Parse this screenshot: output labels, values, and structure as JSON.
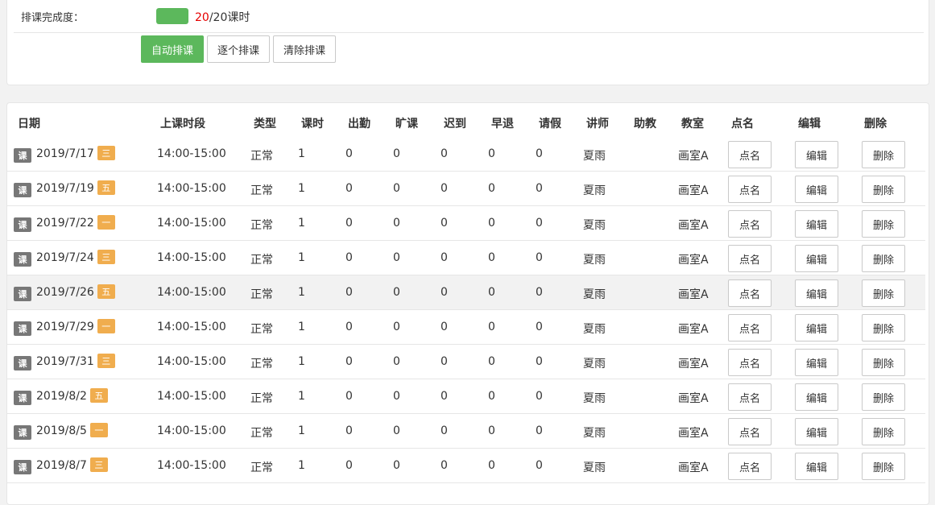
{
  "progress": {
    "label": "排课完成度：",
    "done": "20",
    "total_text": "/20课时",
    "fraction": 1.0,
    "color": "#5cb85c"
  },
  "buttons": {
    "auto": "自动排课",
    "single": "逐个排课",
    "clear": "清除排课"
  },
  "table": {
    "headers": [
      "日期",
      "上课时段",
      "类型",
      "课时",
      "出勤",
      "旷课",
      "迟到",
      "早退",
      "请假",
      "讲师",
      "助教",
      "教室",
      "点名",
      "编辑",
      "删除"
    ],
    "row_tag": "课",
    "action_labels": {
      "rollcall": "点名",
      "edit": "编辑",
      "delete": "删除"
    },
    "rows": [
      {
        "date": "2019/7/17",
        "weekday": "三",
        "time": "14:00-15:00",
        "type": "正常",
        "hours": "1",
        "attend": "0",
        "absent": "0",
        "late": "0",
        "early": "0",
        "leave": "0",
        "teacher": "夏雨",
        "assistant": "",
        "room": "画室A"
      },
      {
        "date": "2019/7/19",
        "weekday": "五",
        "time": "14:00-15:00",
        "type": "正常",
        "hours": "1",
        "attend": "0",
        "absent": "0",
        "late": "0",
        "early": "0",
        "leave": "0",
        "teacher": "夏雨",
        "assistant": "",
        "room": "画室A"
      },
      {
        "date": "2019/7/22",
        "weekday": "一",
        "time": "14:00-15:00",
        "type": "正常",
        "hours": "1",
        "attend": "0",
        "absent": "0",
        "late": "0",
        "early": "0",
        "leave": "0",
        "teacher": "夏雨",
        "assistant": "",
        "room": "画室A"
      },
      {
        "date": "2019/7/24",
        "weekday": "三",
        "time": "14:00-15:00",
        "type": "正常",
        "hours": "1",
        "attend": "0",
        "absent": "0",
        "late": "0",
        "early": "0",
        "leave": "0",
        "teacher": "夏雨",
        "assistant": "",
        "room": "画室A"
      },
      {
        "date": "2019/7/26",
        "weekday": "五",
        "time": "14:00-15:00",
        "type": "正常",
        "hours": "1",
        "attend": "0",
        "absent": "0",
        "late": "0",
        "early": "0",
        "leave": "0",
        "teacher": "夏雨",
        "assistant": "",
        "room": "画室A"
      },
      {
        "date": "2019/7/29",
        "weekday": "一",
        "time": "14:00-15:00",
        "type": "正常",
        "hours": "1",
        "attend": "0",
        "absent": "0",
        "late": "0",
        "early": "0",
        "leave": "0",
        "teacher": "夏雨",
        "assistant": "",
        "room": "画室A"
      },
      {
        "date": "2019/7/31",
        "weekday": "三",
        "time": "14:00-15:00",
        "type": "正常",
        "hours": "1",
        "attend": "0",
        "absent": "0",
        "late": "0",
        "early": "0",
        "leave": "0",
        "teacher": "夏雨",
        "assistant": "",
        "room": "画室A"
      },
      {
        "date": "2019/8/2",
        "weekday": "五",
        "time": "14:00-15:00",
        "type": "正常",
        "hours": "1",
        "attend": "0",
        "absent": "0",
        "late": "0",
        "early": "0",
        "leave": "0",
        "teacher": "夏雨",
        "assistant": "",
        "room": "画室A"
      },
      {
        "date": "2019/8/5",
        "weekday": "一",
        "time": "14:00-15:00",
        "type": "正常",
        "hours": "1",
        "attend": "0",
        "absent": "0",
        "late": "0",
        "early": "0",
        "leave": "0",
        "teacher": "夏雨",
        "assistant": "",
        "room": "画室A"
      },
      {
        "date": "2019/8/7",
        "weekday": "三",
        "time": "14:00-15:00",
        "type": "正常",
        "hours": "1",
        "attend": "0",
        "absent": "0",
        "late": "0",
        "early": "0",
        "leave": "0",
        "teacher": "夏雨",
        "assistant": "",
        "room": "画室A"
      }
    ],
    "highlighted_row": 4
  },
  "colors": {
    "primary": "#5cb85c",
    "weekday_tag": "#f0ad4e",
    "row_tag": "#777777",
    "done_count": "#e60000"
  }
}
